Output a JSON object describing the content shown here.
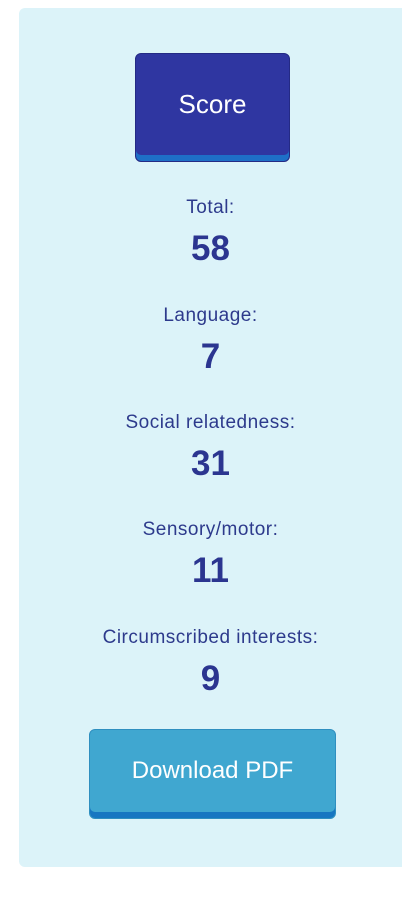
{
  "score_button": {
    "label": "Score"
  },
  "metrics": [
    {
      "label": "Total:",
      "value": "58"
    },
    {
      "label": "Language:",
      "value": "7"
    },
    {
      "label": "Social relatedness:",
      "value": "31"
    },
    {
      "label": "Sensory/motor:",
      "value": "11"
    },
    {
      "label": "Circumscribed interests:",
      "value": "9"
    }
  ],
  "download_button": {
    "label": "Download PDF"
  },
  "colors": {
    "panel_bg": "#dcf3f9",
    "score_button_bg": "#2f36a1",
    "download_button_bg": "#40a7d0",
    "text": "#2d3a8c"
  }
}
